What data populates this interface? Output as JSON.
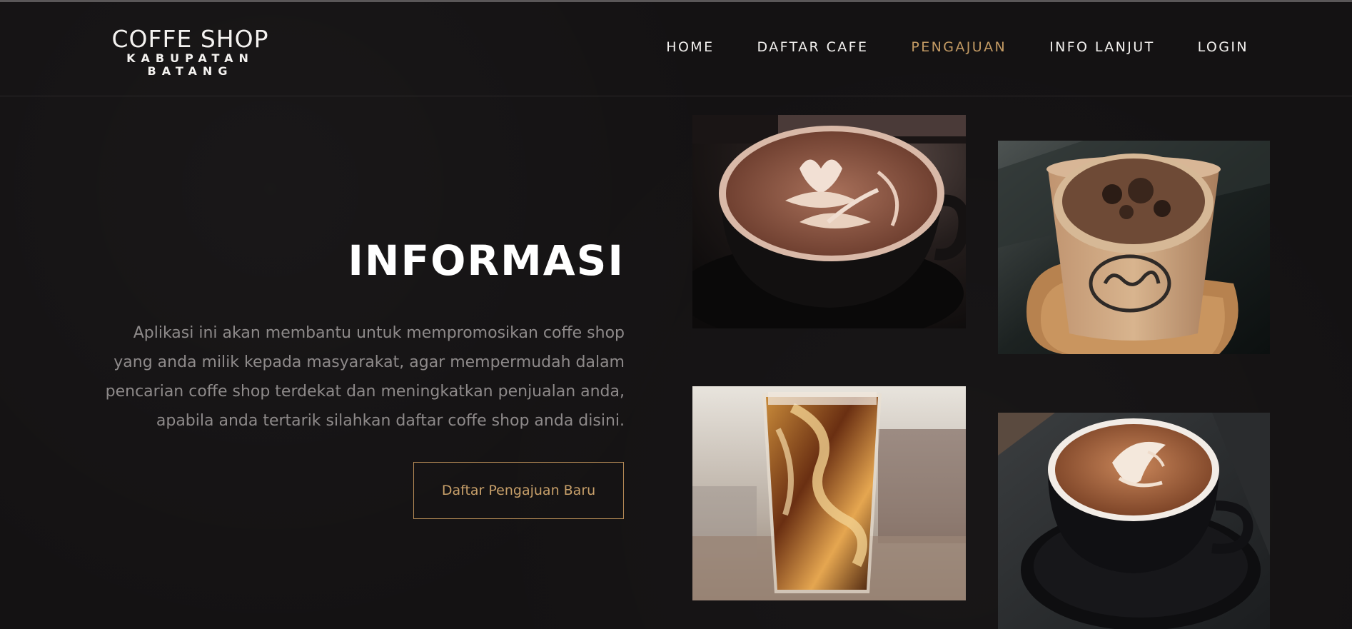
{
  "brand": {
    "title": "COFFE SHOP",
    "subtitle": "KABUPATAN BATANG"
  },
  "nav": {
    "items": [
      {
        "label": "HOME",
        "active": false
      },
      {
        "label": "DAFTAR CAFE",
        "active": false
      },
      {
        "label": "PENGAJUAN",
        "active": true
      },
      {
        "label": "INFO LANJUT",
        "active": false
      },
      {
        "label": "LOGIN",
        "active": false
      }
    ]
  },
  "hero": {
    "title": "INFORMASI",
    "description_lines": [
      "Aplikasi ini akan membantu untuk mempromosikan coffe shop",
      "yang anda milik kepada masyarakat, agar mempermudah dalam",
      "pencarian coffe shop terdekat dan meningkatkan penjualan anda,",
      "apabila anda tertarik silahkan daftar coffe shop anda disini."
    ],
    "cta_label": "Daftar Pengajuan Baru"
  },
  "gallery": [
    {
      "icon": "latte-art-cup-image"
    },
    {
      "icon": "paper-cup-coffee-image"
    },
    {
      "icon": "iced-coffee-glass-image"
    },
    {
      "icon": "cappuccino-cup-image"
    }
  ],
  "colors": {
    "background": "#141213",
    "accent": "#c49b64",
    "text": "#f3f1ef",
    "muted_text": "#8e8a8a"
  }
}
